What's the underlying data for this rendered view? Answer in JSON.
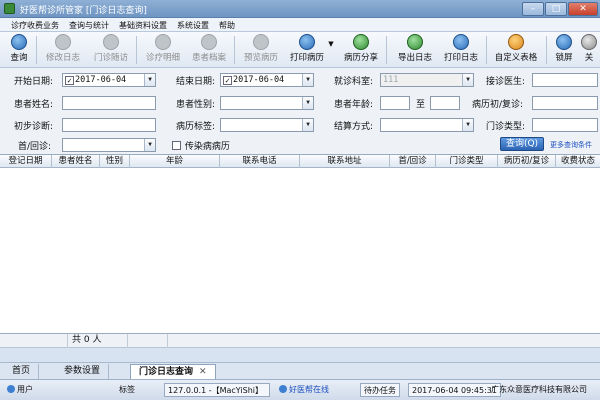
{
  "window": {
    "title": "好医帮诊所管家 [门诊日志查询]",
    "controls": {
      "minimize": "–",
      "maximize": "□",
      "close": "✕"
    }
  },
  "menu": [
    "诊疗收费业务",
    "查询与统计",
    "基础资料设置",
    "系统设置",
    "帮助"
  ],
  "toolbar": {
    "buttons": [
      {
        "label": "查询",
        "icon": "search-icon"
      },
      {
        "label": "修改日志",
        "icon": "edit-log-icon"
      },
      {
        "label": "门诊随访",
        "icon": "follow-up-icon"
      },
      {
        "label": "诊疗明细",
        "icon": "detail-icon"
      },
      {
        "label": "患者档案",
        "icon": "patient-file-icon"
      },
      {
        "label": "预览病历",
        "icon": "preview-icon"
      },
      {
        "label": "打印病历",
        "icon": "print-icon"
      },
      {
        "label": "病历分享",
        "icon": "share-icon"
      },
      {
        "label": "导出日志",
        "icon": "export-icon"
      },
      {
        "label": "打印日志",
        "icon": "print-log-icon"
      },
      {
        "label": "自定义表格",
        "icon": "table-icon"
      },
      {
        "label": "锁屏",
        "icon": "lock-icon"
      },
      {
        "label": "关",
        "icon": "close-icon"
      }
    ],
    "dropdown_arrow": "▼"
  },
  "filters": {
    "start_date_label": "开始日期:",
    "start_date_value": "2017-06-04",
    "end_date_label": "结束日期:",
    "end_date_value": "2017-06-04",
    "department_label": "就诊科室:",
    "department_value": "111",
    "doctor_label": "接诊医生:",
    "patient_name_label": "患者姓名:",
    "gender_label": "患者性别:",
    "age_label": "患者年龄:",
    "age_to": "至",
    "record_type_label": "病历初/复诊:",
    "diagnosis_label": "初步诊断:",
    "record_tag_label": "病历标签:",
    "settlement_label": "结算方式:",
    "clinic_type_label": "门诊类型:",
    "first_return_label": "首/回诊:",
    "infectious_label": "传染病病历",
    "query_button": "查询(Q)",
    "more_link": "更多查询条件",
    "checked_mark": "✓",
    "dropdown_arrow": "▼"
  },
  "grid": {
    "columns": [
      "登记日期",
      "患者姓名",
      "性别",
      "年龄",
      "联系电话",
      "联系地址",
      "首/回诊",
      "门诊类型",
      "病历初/复诊",
      "收费状态"
    ],
    "footer_total": "共 0 人"
  },
  "tabs": [
    {
      "label": "首页"
    },
    {
      "label": "参数设置"
    },
    {
      "label": "门诊日志查询",
      "active": true,
      "close": "✕"
    }
  ],
  "status": {
    "user_label": "用户",
    "version_label": "标签",
    "ip_info": "127.0.0.1 -【MacYiShi】",
    "online": "好医帮在线",
    "todo": "待办任务",
    "datetime": "2017-06-04 09:45:31",
    "company": "广东众意医疗科技有限公司"
  }
}
